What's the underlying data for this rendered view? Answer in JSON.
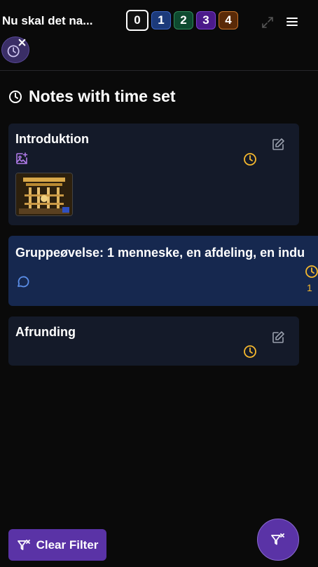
{
  "header": {
    "title": "Nu skal det na...",
    "levels": [
      "0",
      "1",
      "2",
      "3",
      "4"
    ]
  },
  "section": {
    "title": "Notes with time set"
  },
  "notes": [
    {
      "title": "Introduktion"
    },
    {
      "title": "Gruppeøvelse: 1 menneske, en afdeling, en indu",
      "clipped_text": "1"
    },
    {
      "title": "Afrunding"
    }
  ],
  "footer": {
    "clear_filter_label": "Clear Filter"
  },
  "colors": {
    "background": "#0a0a0a",
    "card": "#141a29",
    "card_active": "#16284f",
    "accent": "#5a33a6",
    "clock": "#f5b82e",
    "media": "#b07be8",
    "comment": "#5b8ee8"
  }
}
